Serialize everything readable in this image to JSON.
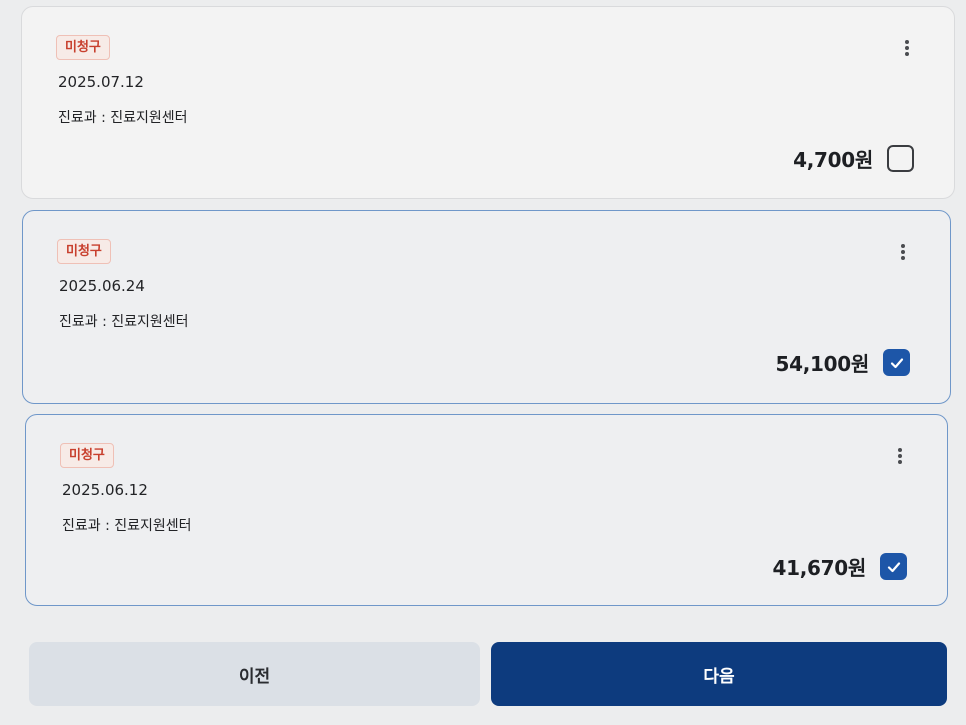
{
  "claims": [
    {
      "badge": "미청구",
      "date": "2025.07.12",
      "department": "진료과 : 진료지원센터",
      "amount": "4,700원",
      "checked": false
    },
    {
      "badge": "미청구",
      "date": "2025.06.24",
      "department": "진료과 : 진료지원센터",
      "amount": "54,100원",
      "checked": true
    },
    {
      "badge": "미청구",
      "date": "2025.06.12",
      "department": "진료과 : 진료지원센터",
      "amount": "41,670원",
      "checked": true
    }
  ],
  "icons": {
    "more": "more-vertical-icon",
    "check": "check-icon"
  },
  "colors": {
    "badge_text": "#c8402e",
    "checkbox_checked": "#1d56a8",
    "next_button": "#0d3b7e",
    "prev_button": "#dbe0e6",
    "selected_border": "#6f97c9"
  },
  "footer": {
    "prev_label": "이전",
    "next_label": "다음"
  }
}
